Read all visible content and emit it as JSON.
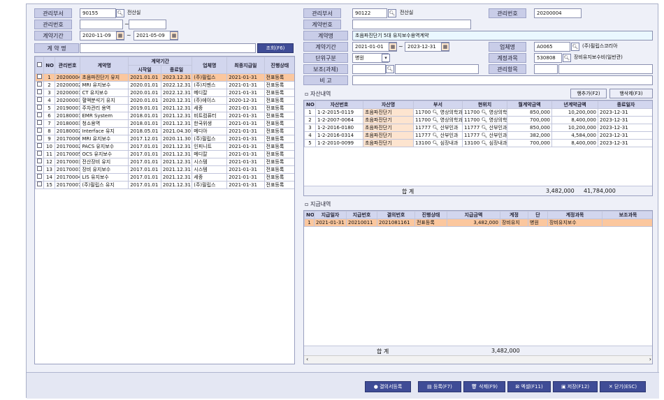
{
  "left": {
    "labels": {
      "dept": "관리부서",
      "mgmt_no": "관리번호",
      "period": "계약기간",
      "contract_name": "계 약 명"
    },
    "dept_code": "90155",
    "dept_name": "전산실",
    "period_sep": "~",
    "date_from": "2020-11-09",
    "date_to": "2021-05-09",
    "search_btn": "조회(F6)",
    "headers": {
      "no": "NO",
      "mgmt_no": "관리번호",
      "name": "계약명",
      "period": "계약기간",
      "start": "시작일",
      "end": "종료일",
      "vendor": "업체명",
      "last_pay": "최종지급일",
      "status": "진행상태"
    },
    "rows": [
      {
        "no": "1",
        "id": "20200004",
        "name": "초음파진단기 유지",
        "start": "2021.01.01",
        "end": "2023.12.31",
        "vendor": "(주)필립스",
        "pay": "2021-01-31",
        "status": "전표등록"
      },
      {
        "no": "2",
        "id": "20200002",
        "name": "MRI 유지보수",
        "start": "2020.01.01",
        "end": "2022.12.31",
        "vendor": "(주)지멘스",
        "pay": "2021-01-31",
        "status": "전표등록"
      },
      {
        "no": "3",
        "id": "20200001",
        "name": "CT 유지보수",
        "start": "2020.01.01",
        "end": "2022.12.31",
        "vendor": "메디칼",
        "pay": "2021-01-31",
        "status": "전표등록"
      },
      {
        "no": "4",
        "id": "20200003",
        "name": "혈액분석기 유지",
        "start": "2020.01.01",
        "end": "2020.12.31",
        "vendor": "(주)에이스",
        "pay": "2020-12-31",
        "status": "전표등록"
      },
      {
        "no": "5",
        "id": "20190001",
        "name": "주차관리 용역",
        "start": "2019.01.01",
        "end": "2021.12.31",
        "vendor": "세종",
        "pay": "2021-01-31",
        "status": "전표등록"
      },
      {
        "no": "6",
        "id": "20180001",
        "name": "EMR System",
        "start": "2018.01.01",
        "end": "2021.12.31",
        "vendor": "비트컴퓨터",
        "pay": "2021-01-31",
        "status": "전표등록"
      },
      {
        "no": "7",
        "id": "20180003",
        "name": "청소용역",
        "start": "2018.01.01",
        "end": "2021.12.31",
        "vendor": "한국위생",
        "pay": "2021-01-31",
        "status": "전표등록"
      },
      {
        "no": "8",
        "id": "20180002",
        "name": "Interface 유지",
        "start": "2018.05.01",
        "end": "2021.04.30",
        "vendor": "메디아",
        "pay": "2021-01-31",
        "status": "전표등록"
      },
      {
        "no": "9",
        "id": "20170006",
        "name": "MRI 유지보수",
        "start": "2017.12.01",
        "end": "2020.11.30",
        "vendor": "(주)필립스",
        "pay": "2021-01-31",
        "status": "전표등록"
      },
      {
        "no": "10",
        "id": "20170002",
        "name": "PACS 유지보수",
        "start": "2017.01.01",
        "end": "2021.12.31",
        "vendor": "인피니트",
        "pay": "2021-01-31",
        "status": "전표등록"
      },
      {
        "no": "11",
        "id": "20170005",
        "name": "OCS 유지보수",
        "start": "2017.01.01",
        "end": "2021.12.31",
        "vendor": "메디칼",
        "pay": "2021-01-31",
        "status": "전표등록"
      },
      {
        "no": "12",
        "id": "20170003",
        "name": "전산장비 유지",
        "start": "2017.01.01",
        "end": "2021.12.31",
        "vendor": "시스템",
        "pay": "2021-01-31",
        "status": "전표등록"
      },
      {
        "no": "13",
        "id": "20170001",
        "name": "장비 유지보수",
        "start": "2017.01.01",
        "end": "2021.12.31",
        "vendor": "시스템",
        "pay": "2021-01-31",
        "status": "전표등록"
      },
      {
        "no": "14",
        "id": "20170004",
        "name": "LIS 유지보수",
        "start": "2017.01.01",
        "end": "2021.12.31",
        "vendor": "세종",
        "pay": "2021-01-31",
        "status": "전표등록"
      },
      {
        "no": "15",
        "id": "20170007",
        "name": "(주)필립스 유지",
        "start": "2017.01.01",
        "end": "2021.12.31",
        "vendor": "(주)필립스",
        "pay": "2021-01-31",
        "status": "전표등록"
      }
    ]
  },
  "right": {
    "labels": {
      "dept": "관리부서",
      "contract_no": "계약번호",
      "contract_name": "계약명",
      "period": "계약기간",
      "unit": "단위구분",
      "support": "보조(과제)",
      "note": "비 고",
      "mgmt_no": "관리번호",
      "vendor": "업체명",
      "account": "계정과목",
      "mgmt_item": "관리항목"
    },
    "dept_code": "90122",
    "dept_name": "전산실",
    "mgmt_no": "20200004",
    "contract_name": "초음파진단기 5대 유지보수용역계약",
    "date_from": "2021-01-01",
    "date_sep": "~",
    "date_to": "2023-12-31",
    "vendor_code": "A0065",
    "vendor_name": "(주)필립스코리아",
    "unit": "병원",
    "account_code": "530808",
    "account_name": "장비유지보수비(일반관)",
    "asset_title": "자산내역",
    "add_row": "행추가(F2)",
    "del_row": "행삭제(F3)",
    "asset_headers": {
      "no": "NO",
      "asset_no": "자산번호",
      "asset_name": "자산명",
      "dept": "부서",
      "location": "현위치",
      "monthly": "월계약금액",
      "yearly": "년계약금액",
      "end": "종료일자"
    },
    "assets": [
      {
        "no": "1",
        "asset_no": "1-2-2015-0119",
        "name": "초음파진단기",
        "dept": "11700",
        "deptname": "영상의학과",
        "loc": "11700",
        "locname": "영상의학과",
        "monthly": "850,000",
        "yearly": "10,200,000",
        "end": "2023-12-31"
      },
      {
        "no": "2",
        "asset_no": "1-2-2007-0064",
        "name": "초음파진단기",
        "dept": "11700",
        "deptname": "영상의학과",
        "loc": "11700",
        "locname": "영상의학과",
        "monthly": "700,000",
        "yearly": "8,400,000",
        "end": "2023-12-31"
      },
      {
        "no": "3",
        "asset_no": "1-2-2016-0180",
        "name": "초음파진단기",
        "dept": "11777",
        "deptname": "산부인과",
        "loc": "11777",
        "locname": "산부인과",
        "monthly": "850,000",
        "yearly": "10,200,000",
        "end": "2023-12-31"
      },
      {
        "no": "4",
        "asset_no": "1-2-2016-0314",
        "name": "초음파진단기",
        "dept": "11777",
        "deptname": "산부인과",
        "loc": "11777",
        "locname": "산부인과",
        "monthly": "382,000",
        "yearly": "4,584,000",
        "end": "2023-12-31"
      },
      {
        "no": "5",
        "asset_no": "1-2-2010-0099",
        "name": "초음파진단기",
        "dept": "13100",
        "deptname": "심장내과",
        "loc": "13100",
        "locname": "심장내과",
        "monthly": "700,000",
        "yearly": "8,400,000",
        "end": "2023-12-31"
      }
    ],
    "asset_sum_label": "합  계",
    "asset_sum_monthly": "3,482,000",
    "asset_sum_yearly": "41,784,000",
    "pay_title": "지급내역",
    "pay_headers": {
      "no": "NO",
      "date": "지급일자",
      "pay_no": "지급번호",
      "doc_no": "결의번호",
      "status": "진행상태",
      "amount": "지급금액",
      "acct": "계정",
      "unit": "단",
      "acct_name": "계정과목",
      "support": "보조과목"
    },
    "pays": [
      {
        "no": "1",
        "date": "2021-01-31",
        "pay_no": "20210011",
        "doc_no": "2021081161",
        "status": "전표등록",
        "amount": "3,482,000",
        "acct": "장비유지",
        "unit": "병원",
        "acct_name": "장비유지보수",
        "support": ""
      }
    ],
    "pay_sum_label": "합  계",
    "pay_sum": "3,482,000"
  },
  "footer": {
    "resolution": "결의서등록",
    "register": "등록(F7)",
    "delete": "삭제(F9)",
    "excel": "엑셀(F11)",
    "save": "저장(F12)",
    "close": "닫기(ESC)"
  }
}
